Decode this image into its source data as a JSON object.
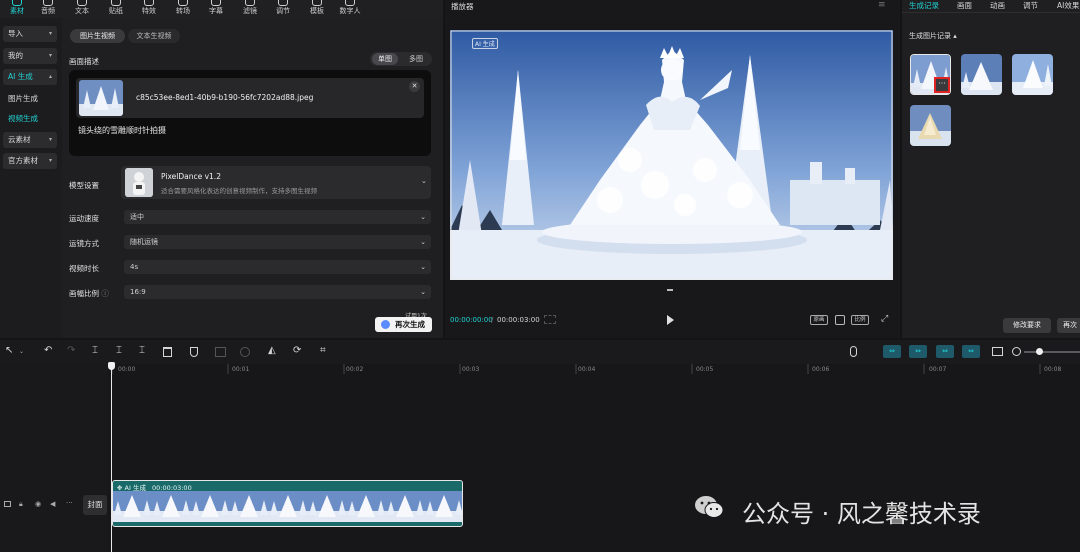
{
  "topbar": {
    "items": [
      {
        "label": "素材",
        "icon": "media-icon",
        "active": true
      },
      {
        "label": "音频",
        "icon": "audio-icon"
      },
      {
        "label": "文本",
        "icon": "text-icon"
      },
      {
        "label": "贴纸",
        "icon": "sticker-icon"
      },
      {
        "label": "特效",
        "icon": "effects-icon"
      },
      {
        "label": "转场",
        "icon": "transition-icon"
      },
      {
        "label": "字幕",
        "icon": "subtitle-icon"
      },
      {
        "label": "滤镜",
        "icon": "filter-icon"
      },
      {
        "label": "调节",
        "icon": "adjust-icon"
      },
      {
        "label": "模板",
        "icon": "template-icon"
      },
      {
        "label": "数字人",
        "icon": "digital-human-icon"
      }
    ]
  },
  "leftnav": {
    "items": [
      {
        "label": "导入",
        "style": "box",
        "caret": "▾"
      },
      {
        "label": "我的",
        "style": "box",
        "caret": "▾"
      },
      {
        "label": "AI 生成",
        "style": "ai",
        "caret": "▴"
      },
      {
        "label": "图片生成",
        "style": "plain"
      },
      {
        "label": "视频生成",
        "style": "sel"
      },
      {
        "label": "云素材",
        "style": "box",
        "caret": "▾"
      },
      {
        "label": "官方素材",
        "style": "box",
        "caret": "▾"
      }
    ]
  },
  "generator": {
    "tabs": [
      "图片生视频",
      "文本生视频"
    ],
    "desc_label": "画面描述",
    "mode_toggle": [
      "单图",
      "多图"
    ],
    "filename": "c85c53ee-8ed1-40b9-b190-56fc7202ad88.jpeg",
    "prompt": "镜头绕的雪雕顺时针拍摄",
    "model_label": "模型设置",
    "model_name": "PixelDance v1.2",
    "model_desc": "适合需要风格化表达的创意视频制作，支持多图生视频",
    "speed_label": "运动速度",
    "speed_value": "适中",
    "camera_label": "运镜方式",
    "camera_value": "随机运镜",
    "duration_label": "视频时长",
    "duration_value": "4s",
    "ratio_label": "画幅比例",
    "ratio_info": "ⓘ",
    "ratio_value": "16:9",
    "trial_text": "试用1次",
    "regen_button": "再次生成"
  },
  "player": {
    "title": "播放器",
    "watermark": "AI 生成",
    "time_current": "00:00:00:00",
    "time_separator": "/",
    "time_total": "00:00:03:00",
    "btn_original": "原画",
    "btn_ratio": "比例"
  },
  "rightpanel": {
    "tabs": [
      "生成记录",
      "画面",
      "动画",
      "调节",
      "AI效果"
    ],
    "records_label": "生成图片记录",
    "records_caret": "▴",
    "more_label": "···",
    "modify_button": "修改要求",
    "regen_button": "再次"
  },
  "timeline": {
    "ticks": [
      "00:00",
      "00:01",
      "00:02",
      "00:03",
      "00:04",
      "00:05",
      "00:06",
      "00:07",
      "00:08"
    ],
    "cover_label": "封面",
    "clip_tag": "AI 生成",
    "clip_duration": "00:00:03:00"
  },
  "watermark_overlay": "公众号 · 风之馨技术录",
  "colors": {
    "accent": "#22d3d3",
    "clip": "#1b6a6a",
    "highlight_red": "#e02424"
  }
}
